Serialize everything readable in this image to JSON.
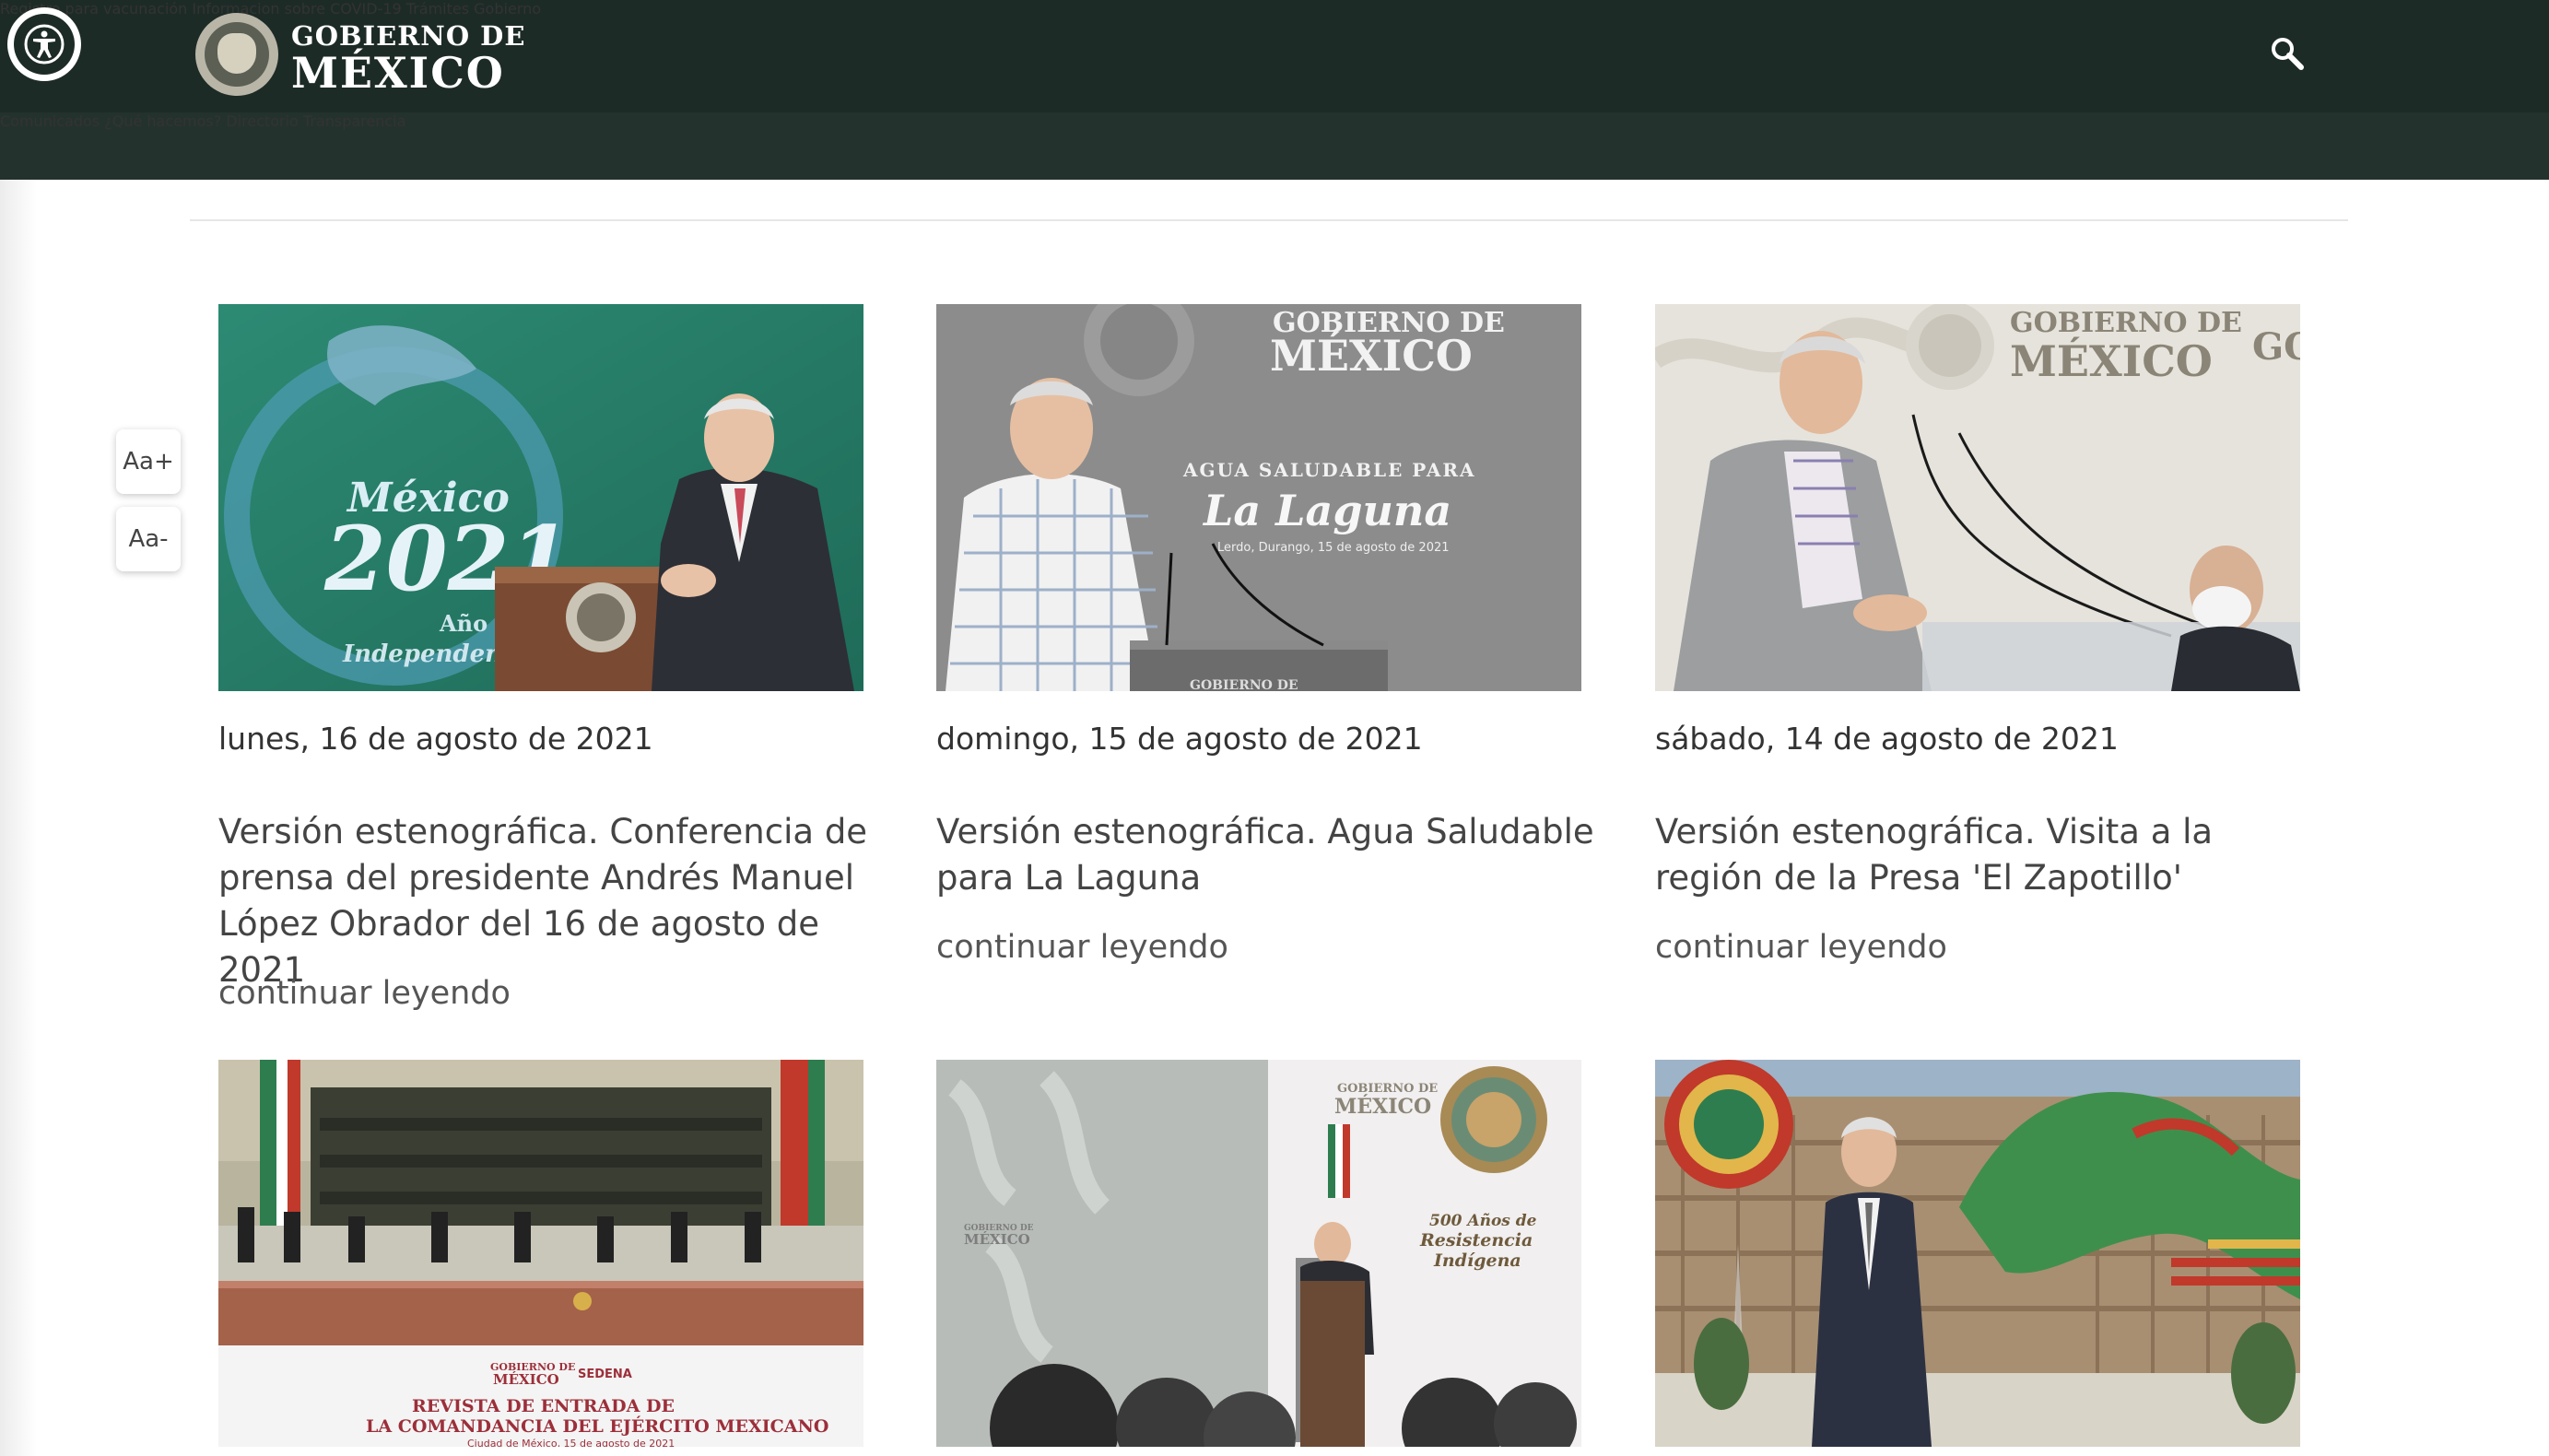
{
  "header": {
    "logo": {
      "line1": "GOBIERNO DE",
      "line2": "MÉXICO"
    },
    "main_nav": [
      "Registro para vacunación",
      "Informacion sobre COVID-19",
      "Trámites",
      "Gobierno"
    ],
    "sub_nav": [
      "Comunicados",
      "¿Qué hacemos?",
      "Directorio",
      "Transparencia"
    ],
    "icons": [
      "accessibility-icon",
      "search-icon"
    ]
  },
  "font_controls": {
    "increase": "Aa+",
    "decrease": "Aa-"
  },
  "cards": [
    {
      "date": "lunes, 16 de agosto de 2021",
      "title": "Versión estenográfica. Conferencia de prensa del presidente Andrés Manuel López Obrador del 16 de agosto de 2021",
      "more": "continuar leyendo",
      "image_text": {
        "l1": "México",
        "l2": "2021",
        "l3": "Año de la",
        "l4": "Independencia"
      }
    },
    {
      "date": "domingo, 15 de agosto de 2021",
      "title": "Versión estenográfica. Agua Saludable para La Laguna",
      "more": "continuar leyendo",
      "image_text": {
        "l1": "GOBIERNO DE",
        "l2": "MÉXICO",
        "l3": "AGUA SALUDABLE PARA",
        "l4": "La Laguna",
        "l5": "Lerdo, Durango, 15 de agosto de 2021",
        "l6": "GOBIERNO DE"
      }
    },
    {
      "date": "sábado, 14 de agosto de 2021",
      "title": "Versión estenográfica. Visita a la región de la Presa 'El Zapotillo'",
      "more": "continuar leyendo",
      "image_text": {
        "l1": "GOBIERNO DE",
        "l2": "MÉXICO",
        "l3": "GO"
      }
    },
    {
      "image_text": {
        "l1": "GOBIERNO DE",
        "l2": "MÉXICO",
        "l3": "SEDENA",
        "l4": "REVISTA DE ENTRADA DE",
        "l5": "LA COMANDANCIA DEL EJÉRCITO MEXICANO",
        "l6": "Ciudad de México, 15 de agosto de 2021"
      }
    },
    {
      "image_text": {
        "l1": "GOBIERNO DE",
        "l2": "MÉXICO",
        "l3": "500 Años de",
        "l4": "Resistencia",
        "l5": "Indígena",
        "l6": "GOBIERNO DE MÉXICO"
      }
    },
    {
      "image_text": {}
    }
  ],
  "colors": {
    "header_bg": "#1d2b27",
    "subheader_bg": "#24322d",
    "text": "#333333"
  }
}
